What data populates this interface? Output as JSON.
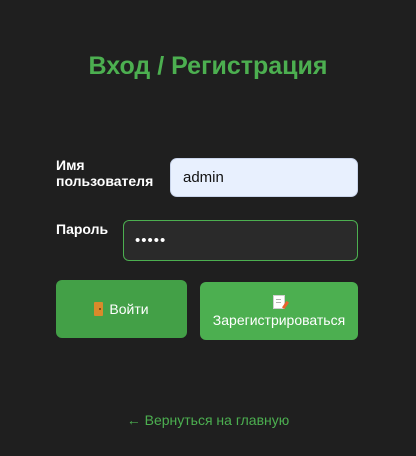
{
  "header": {
    "title": "Вход / Регистрация"
  },
  "form": {
    "username_label": "Имя пользователя",
    "username_value": "admin",
    "password_label": "Пароль",
    "password_value": "•••••"
  },
  "actions": {
    "login_label": "Войти",
    "login_icon": "door-icon",
    "register_label": "Зарегистрироваться",
    "register_icon": "memo-icon"
  },
  "footer": {
    "back_link": "← Вернуться на главную"
  },
  "colors": {
    "accent": "#4caf50",
    "background": "#1f1f1f"
  }
}
